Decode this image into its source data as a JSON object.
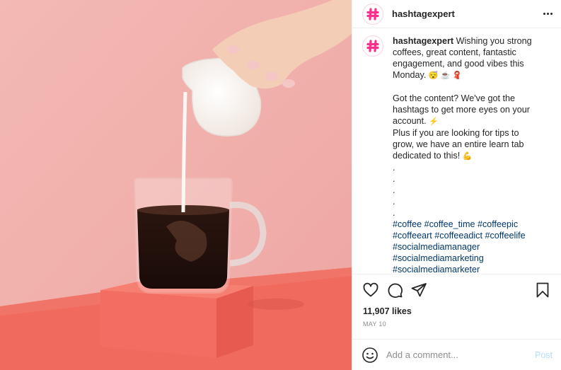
{
  "header": {
    "username": "hashtagexpert",
    "more_icon": "ellipsis-icon"
  },
  "caption": {
    "username": "hashtagexpert",
    "line1": "Wishing you strong coffees, great content, fantastic engagement, and good vibes this Monday.",
    "line1_emoji": "😴 ☕ 🧣",
    "para2": "Got the content? We've got the hashtags to get more eyes on your account.",
    "para2_emoji": "⚡",
    "para3": "Plus if you are looking for tips to grow, we have an entire learn tab dedicated to this!",
    "para3_emoji": "💪",
    "dots": [
      ".",
      ".",
      ".",
      ".",
      "."
    ],
    "tags_line1": "#coffee #coffee_time #coffeepic",
    "tags_line2": "#coffeeart #coffeeadict #coffeelife",
    "tags_line3": "#socialmediamanager",
    "tags_line4": "#socialmediamarketing",
    "tags_line5": "#socialmediamarketer"
  },
  "actions": {
    "like_icon": "heart-icon",
    "comment_icon": "comment-icon",
    "share_icon": "send-icon",
    "save_icon": "bookmark-icon"
  },
  "likes": "11,907 likes",
  "date": "MAY 10",
  "comment_box": {
    "emoji_icon": "smiley-icon",
    "placeholder": "Add a comment...",
    "post_label": "Post"
  },
  "colors": {
    "brand": "#ff2e8a",
    "link": "#00376b",
    "muted": "#8e8e8e",
    "post_disabled": "#b2dffc",
    "bg_pink": "#f1aaa7",
    "table": "#f06a5e"
  }
}
